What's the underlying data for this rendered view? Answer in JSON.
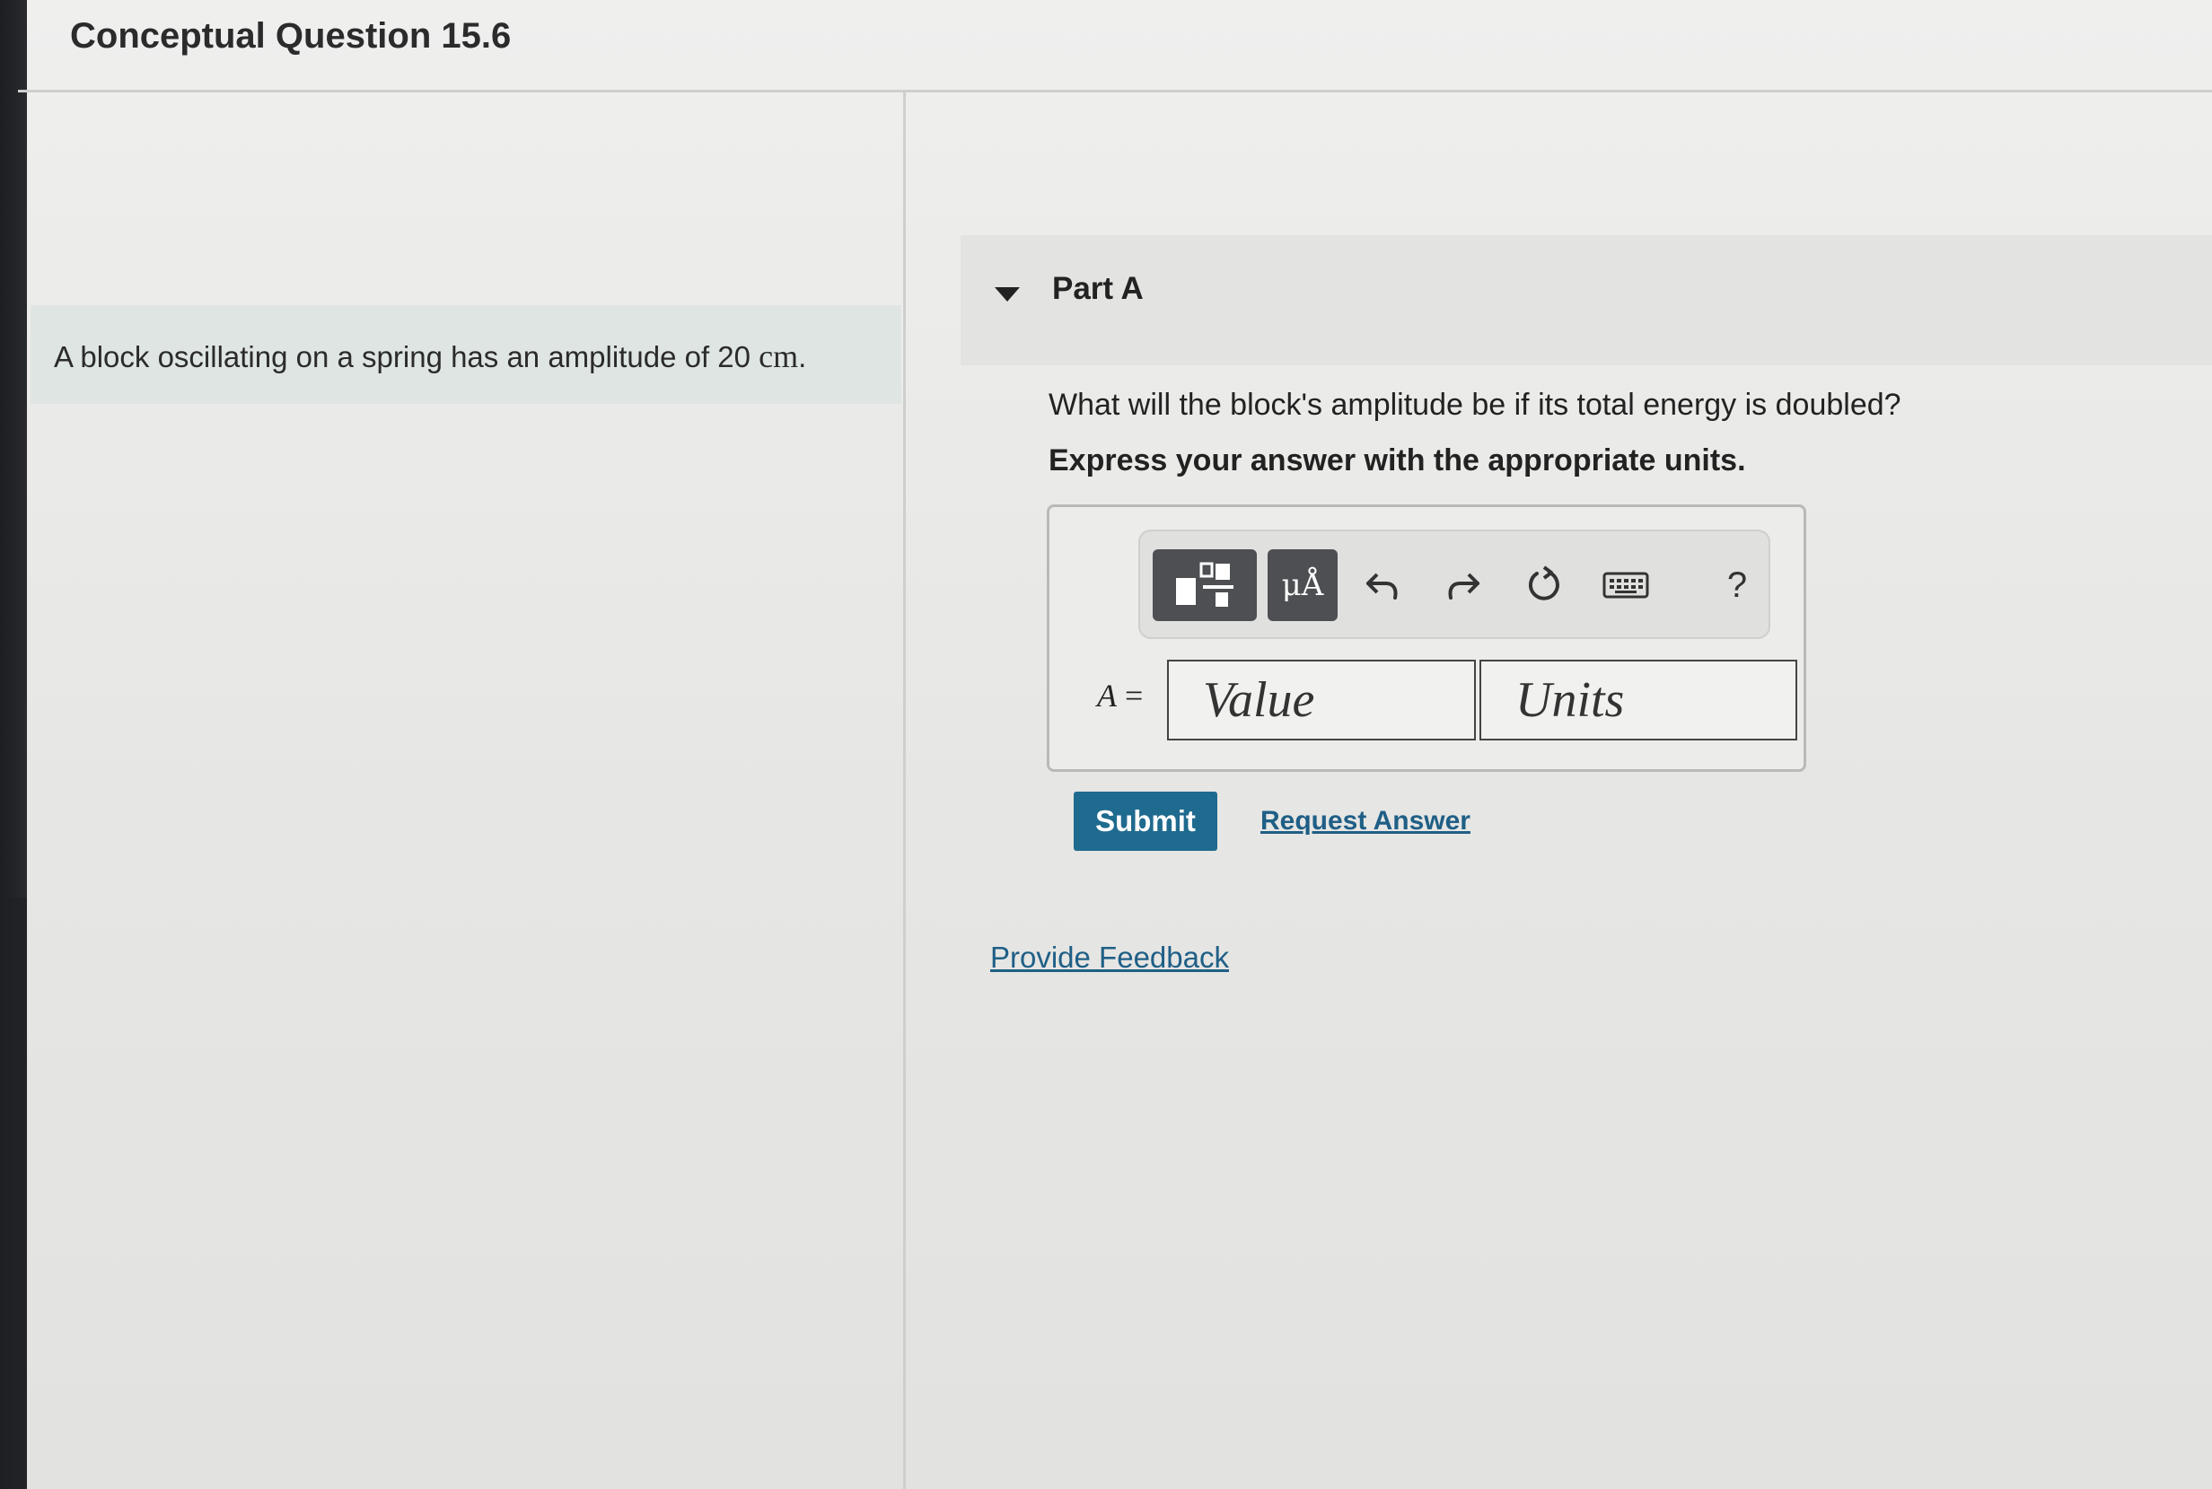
{
  "header": {
    "title": "Conceptual Question 15.6"
  },
  "problem": {
    "statement": "A block oscillating on a spring has an amplitude of 20",
    "unit": "cm",
    "end": "."
  },
  "part": {
    "label": "Part A",
    "question": "What will the block's amplitude be if its total energy is doubled?",
    "instruction": "Express your answer with the appropriate units."
  },
  "toolbar": {
    "icons": [
      "templates-icon",
      "units-icon",
      "undo-icon",
      "redo-icon",
      "reset-icon",
      "keyboard-icon",
      "help-icon"
    ],
    "units_symbol": "μÅ",
    "help_symbol": "?"
  },
  "answer": {
    "variable": "A",
    "equals": "=",
    "value_placeholder": "Value",
    "units_placeholder": "Units"
  },
  "actions": {
    "submit_label": "Submit",
    "request_label": "Request Answer",
    "feedback_label": "Provide Feedback"
  },
  "colors": {
    "submit_bg": "#1f6b8f",
    "link": "#1f5f86",
    "problem_bg": "#dfe5e3"
  }
}
